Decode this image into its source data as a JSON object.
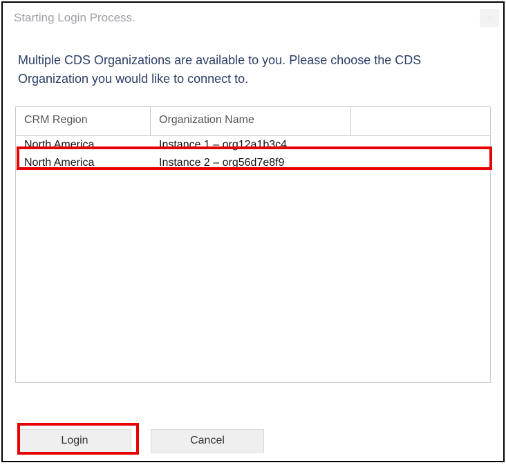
{
  "window": {
    "title": "Starting Login Process.",
    "close_glyph": "×"
  },
  "instructions": "Multiple CDS Organizations are available to you. Please choose the CDS Organization you would like to connect to.",
  "table": {
    "headers": {
      "region": "CRM Region",
      "org": "Organization Name"
    },
    "rows": [
      {
        "region": "North America",
        "org": "Instance 1 – org12a1b3c4",
        "selected": true
      },
      {
        "region": "North America",
        "org": "Instance 2 – org56d7e8f9",
        "selected": false
      }
    ]
  },
  "buttons": {
    "login": "Login",
    "cancel": "Cancel"
  }
}
